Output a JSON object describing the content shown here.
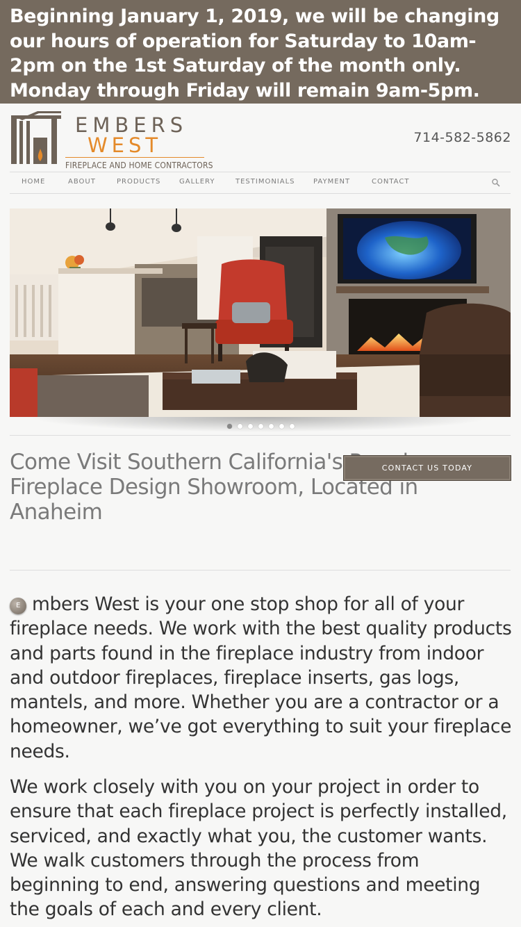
{
  "banner": {
    "text": "Beginning January 1, 2019, we will be changing our hours of operation for Saturday to 10am-2pm on the 1st Saturday of the month only. Monday through Friday will remain 9am-5pm."
  },
  "header": {
    "logo_top": "EMBERS",
    "logo_bottom": "WEST",
    "logo_tagline": "FIREPLACE AND HOME CONTRACTORS",
    "phone": "714-582-5862"
  },
  "nav": {
    "items": [
      "HOME",
      "ABOUT",
      "PRODUCTS",
      "GALLERY",
      "TESTIMONIALS",
      "PAYMENT",
      "CONTACT"
    ]
  },
  "slider": {
    "slide_count": 7,
    "active_index": 0
  },
  "intro": {
    "headline": "Come Visit Southern California's Premiere Fireplace Design Showroom, Located in Anaheim",
    "cta_label": "CONTACT US TODAY"
  },
  "content": {
    "dropcap": "E",
    "para1": "mbers West is your one stop shop for all of your fireplace needs. We work with the best quality products and parts found in the fireplace industry from indoor and outdoor fireplaces, fireplace inserts, gas logs, mantels, and more. Whether you are a contractor or a homeowner, we’ve got everything to suit your fireplace needs.",
    "para2": "We work closely with you on your project in order to ensure that each fireplace project is perfectly installed, serviced, and exactly what you, the customer wants. We walk customers through the process from beginning to end, answering questions and meeting the goals of each and every client."
  },
  "colors": {
    "brand_brown": "#756a5e",
    "brand_orange": "#e48a2a"
  }
}
